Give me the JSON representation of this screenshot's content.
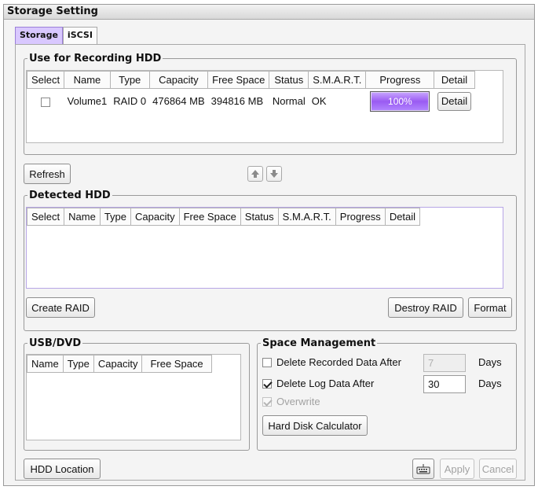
{
  "window": {
    "title": "Storage Setting"
  },
  "tabs": [
    {
      "label": "Storage",
      "active": true
    },
    {
      "label": "iSCSI",
      "active": false
    }
  ],
  "recording_hdd": {
    "legend": "Use for Recording HDD",
    "columns": [
      "Select",
      "Name",
      "Type",
      "Capacity",
      "Free Space",
      "Status",
      "S.M.A.R.T.",
      "Progress",
      "Detail"
    ],
    "rows": [
      {
        "selected": false,
        "name": "Volume1",
        "type": "RAID 0",
        "capacity": "476864 MB",
        "free_space": "394816 MB",
        "status": "Normal",
        "smart": "OK",
        "progress": "100%",
        "detail": "Detail"
      }
    ]
  },
  "refresh_label": "Refresh",
  "move_up_icon": "up-arrow-icon",
  "move_down_icon": "down-arrow-icon",
  "detected_hdd": {
    "legend": "Detected HDD",
    "columns": [
      "Select",
      "Name",
      "Type",
      "Capacity",
      "Free Space",
      "Status",
      "S.M.A.R.T.",
      "Progress",
      "Detail"
    ],
    "rows": []
  },
  "create_raid_label": "Create RAID",
  "destroy_raid_label": "Destroy RAID",
  "format_label": "Format",
  "usb_dvd": {
    "legend": "USB/DVD",
    "columns": [
      "Name",
      "Type",
      "Capacity",
      "Free Space"
    ],
    "rows": []
  },
  "space_management": {
    "legend": "Space Management",
    "delete_recorded": {
      "label": "Delete Recorded Data After",
      "checked": false,
      "value": "7",
      "unit": "Days",
      "enabled": false
    },
    "delete_log": {
      "label": "Delete Log Data After",
      "checked": true,
      "value": "30",
      "unit": "Days",
      "enabled": true
    },
    "overwrite": {
      "label": "Overwrite",
      "checked": true,
      "enabled": false
    },
    "calculator_label": "Hard Disk Calculator"
  },
  "hdd_location_label": "HDD Location",
  "keyboard_icon": "keyboard-icon",
  "apply_label": "Apply",
  "cancel_label": "Cancel",
  "colors": {
    "progress": "#9a5bf2",
    "active_tab": "#d9c8ff"
  }
}
